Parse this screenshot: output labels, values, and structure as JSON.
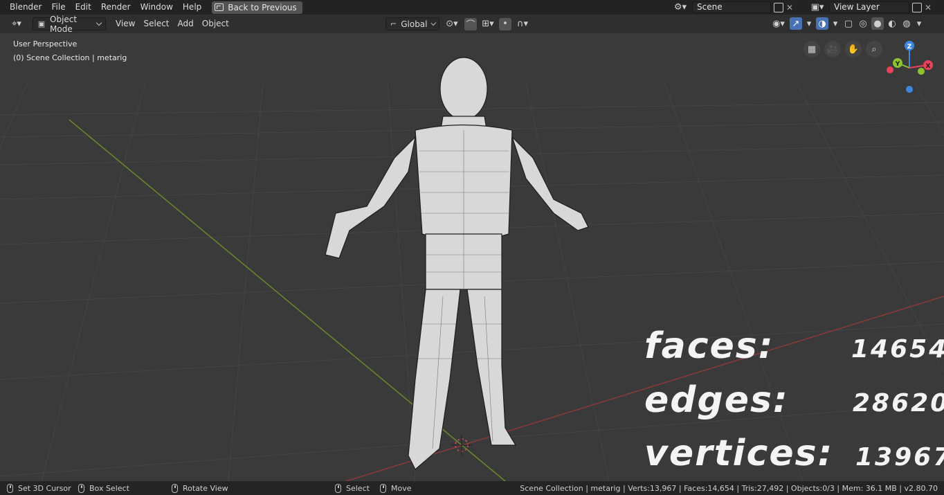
{
  "topbar": {
    "menus": [
      "Blender",
      "File",
      "Edit",
      "Render",
      "Window",
      "Help"
    ],
    "back_button": "Back to Previous",
    "scene_name": "Scene",
    "view_layer": "View Layer"
  },
  "header": {
    "mode": "Object Mode",
    "menus": [
      "View",
      "Select",
      "Add",
      "Object"
    ],
    "orientation": "Global"
  },
  "viewport": {
    "perspective": "User Perspective",
    "collection": "(0) Scene Collection | metarig",
    "gizmo": {
      "z": "Z",
      "y": "Y",
      "x": "X"
    },
    "stats": {
      "faces_label": "faces:",
      "faces_value": "14654",
      "edges_label": "edges:",
      "edges_value": "28620",
      "vertices_label": "vertices:",
      "vertices_value": "13967"
    }
  },
  "statusbar": {
    "set_cursor": "Set 3D Cursor",
    "box_select": "Box Select",
    "rotate_view": "Rotate View",
    "select": "Select",
    "move": "Move",
    "info": "Scene Collection | metarig | Verts:13,967 | Faces:14,654 | Tris:27,492 | Objects:0/3 | Mem: 36.1 MB | v2.80.70"
  },
  "colors": {
    "accent": "#4772b3",
    "x_axis": "#e9425a",
    "y_axis": "#8cc232",
    "z_axis": "#3c88e0"
  }
}
